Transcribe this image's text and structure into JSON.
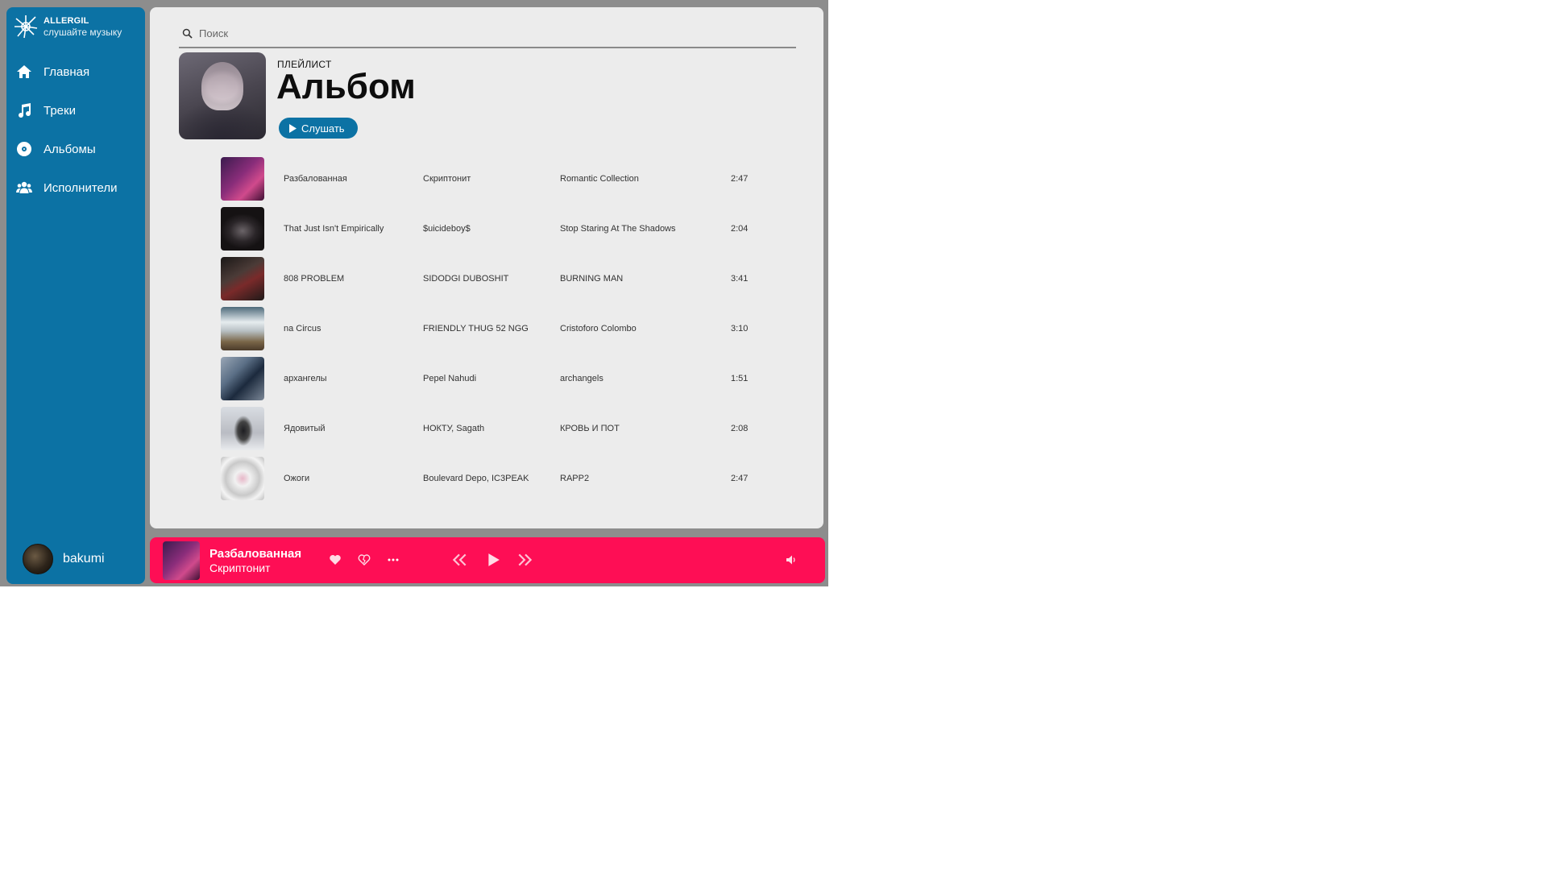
{
  "brand": {
    "name": "ALLERGIL",
    "tagline": "слушайте музыку"
  },
  "nav": {
    "items": [
      {
        "label": "Главная",
        "icon": "home-icon"
      },
      {
        "label": "Треки",
        "icon": "music-note-icon"
      },
      {
        "label": "Альбомы",
        "icon": "disc-icon"
      },
      {
        "label": "Исполнители",
        "icon": "users-icon"
      }
    ]
  },
  "user": {
    "name": "bakumi"
  },
  "search": {
    "placeholder": "Поиск"
  },
  "playlist": {
    "kind": "ПЛЕЙЛИСТ",
    "title": "Альбом",
    "play_label": "Слушать"
  },
  "tracks": [
    {
      "title": "Разбалованная",
      "artist": "Скриптонит",
      "album": "Romantic Collection",
      "duration": "2:47",
      "thumb_color": "#8a2d7a"
    },
    {
      "title": "That Just Isn't Empirically",
      "artist": "$uicideboy$",
      "album": "Stop Staring At The Shadows",
      "duration": "2:04",
      "thumb_color": "#2b2629"
    },
    {
      "title": "808 PROBLEM",
      "artist": "SIDODGI DUBOSHIT",
      "album": "BURNING MAN",
      "duration": "3:41",
      "thumb_color": "#3a2f2c"
    },
    {
      "title": "na Circus",
      "artist": "FRIENDLY THUG 52 NGG",
      "album": "Cristoforo Colombo",
      "duration": "3:10",
      "thumb_color": "#6a7a86"
    },
    {
      "title": "архангелы",
      "artist": "Pepel Nahudi",
      "album": "archangels",
      "duration": "1:51",
      "thumb_color": "#3c4d62"
    },
    {
      "title": "Ядовитый",
      "artist": "НОКТУ, Sagath",
      "album": "КРОВЬ И ПОТ",
      "duration": "2:08",
      "thumb_color": "#b9bcc3"
    },
    {
      "title": "Ожоги",
      "artist": "Boulevard Depo, IC3PEAK",
      "album": "RAPP2",
      "duration": "2:47",
      "thumb_color": "#d8d8d8"
    }
  ],
  "player": {
    "title": "Разбалованная",
    "artist": "Скриптонит"
  },
  "colors": {
    "sidebar": "#0c72a4",
    "player": "#fe0e55",
    "panel": "#ececec",
    "accent_button": "#0c72a4"
  }
}
